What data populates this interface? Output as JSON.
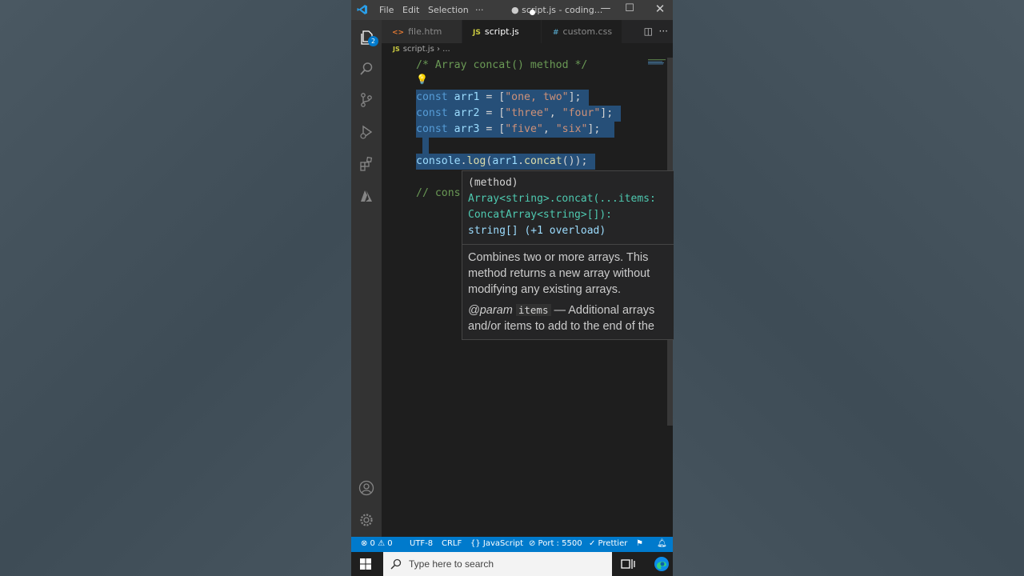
{
  "titlebar": {
    "menu": [
      "File",
      "Edit",
      "Selection",
      "···"
    ],
    "title": "● script.js - coding..."
  },
  "activitybar": {
    "explorer_badge": "2"
  },
  "tabs": [
    {
      "icon": "<>",
      "label": "file.htm",
      "icon_color": "#e37933"
    },
    {
      "icon": "JS",
      "label": "script.js",
      "icon_color": "#cbcb41"
    },
    {
      "icon": "#",
      "label": "custom.css",
      "icon_color": "#519aba"
    }
  ],
  "breadcrumb": {
    "file": "script.js",
    "rest": "..."
  },
  "code": {
    "comment": "/* Array concat() method */",
    "line1": {
      "kw": "const",
      "var": "arr1",
      "eq": " = [",
      "str": "\"one, two\"",
      "end": "];"
    },
    "line2": {
      "kw": "const",
      "var": "arr2",
      "eq": " = [",
      "str1": "\"three\"",
      "comma": ", ",
      "str2": "\"four\"",
      "end": "];"
    },
    "line3": {
      "kw": "const",
      "var": "arr3",
      "eq": " = [",
      "str1": "\"five\"",
      "comma": ", ",
      "str2": "\"six\"",
      "end": "];"
    },
    "line5": {
      "obj": "console",
      "fn": "log",
      "arg": "arr1",
      "method": "concat",
      "end": "());"
    },
    "line7": "// cons"
  },
  "hover": {
    "sig": [
      "(method)",
      "Array<string>.concat(...items:",
      "ConcatArray<string>[]):",
      "string[] (+1 overload)"
    ],
    "doc": "Combines two or more arrays. This method returns a new array without modifying any existing arrays.",
    "param_tag": "@param",
    "param_name": "items",
    "param_desc": " — Additional arrays and/or items to add to the end of the array."
  },
  "statusbar": {
    "problems": "⊗ 0 ⚠ 0",
    "encoding": "UTF-8",
    "eol": "CRLF",
    "language": "{} JavaScript",
    "port": "⊘ Port : 5500",
    "prettier": "✓ Prettier"
  },
  "taskbar": {
    "search_placeholder": "Type here to search"
  },
  "colors": {
    "accent": "#007acc",
    "editor_bg": "#1e1e1e",
    "selection": "#264f78"
  }
}
